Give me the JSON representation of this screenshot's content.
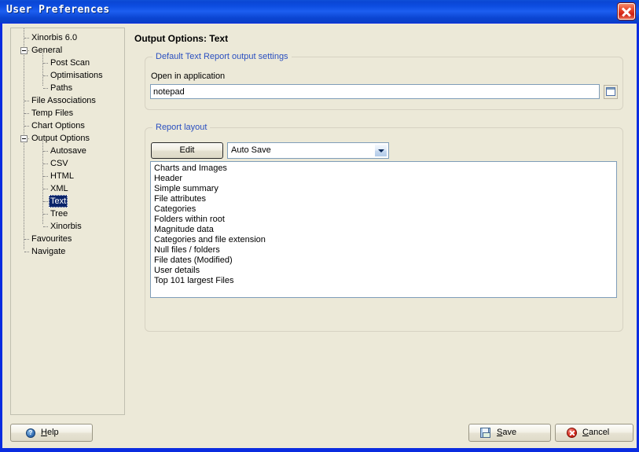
{
  "window": {
    "title": "User Preferences",
    "close_icon": "close-icon"
  },
  "tree": {
    "nodes": [
      {
        "label": "Xinorbis 6.0",
        "depth": 1,
        "expander": null,
        "selected": false
      },
      {
        "label": "General",
        "depth": 1,
        "expander": "collapse",
        "selected": false
      },
      {
        "label": "Post Scan",
        "depth": 2,
        "expander": null,
        "selected": false
      },
      {
        "label": "Optimisations",
        "depth": 2,
        "expander": null,
        "selected": false
      },
      {
        "label": "Paths",
        "depth": 2,
        "expander": null,
        "selected": false
      },
      {
        "label": "File Associations",
        "depth": 1,
        "expander": null,
        "selected": false
      },
      {
        "label": "Temp Files",
        "depth": 1,
        "expander": null,
        "selected": false
      },
      {
        "label": "Chart Options",
        "depth": 1,
        "expander": null,
        "selected": false
      },
      {
        "label": "Output Options",
        "depth": 1,
        "expander": "collapse",
        "selected": false
      },
      {
        "label": "Autosave",
        "depth": 2,
        "expander": null,
        "selected": false
      },
      {
        "label": "CSV",
        "depth": 2,
        "expander": null,
        "selected": false
      },
      {
        "label": "HTML",
        "depth": 2,
        "expander": null,
        "selected": false
      },
      {
        "label": "XML",
        "depth": 2,
        "expander": null,
        "selected": false
      },
      {
        "label": "Text",
        "depth": 2,
        "expander": null,
        "selected": true
      },
      {
        "label": "Tree",
        "depth": 2,
        "expander": null,
        "selected": false
      },
      {
        "label": "Xinorbis",
        "depth": 2,
        "expander": null,
        "selected": false
      },
      {
        "label": "Favourites",
        "depth": 1,
        "expander": null,
        "selected": false
      },
      {
        "label": "Navigate",
        "depth": 1,
        "expander": null,
        "selected": false
      }
    ]
  },
  "page": {
    "title": "Output Options: Text"
  },
  "default_output_group": {
    "legend": "Default Text Report output settings",
    "open_in_application_label": "Open in application",
    "open_in_application_value": "notepad",
    "open_in_application_placeholder": "",
    "browse_icon": "browse-folder-icon"
  },
  "report_layout_group": {
    "legend": "Report layout",
    "edit_button": "Edit",
    "preset_selected": "Auto Save",
    "preset_options": [
      "Auto Save"
    ],
    "items": [
      "Charts and Images",
      "Header",
      "Simple summary",
      "File attributes",
      "Categories",
      "Folders within root",
      "Magnitude data",
      "Categories and file extension",
      "Null files / folders",
      "File dates (Modified)",
      "User details",
      "Top 101 largest Files"
    ]
  },
  "footer": {
    "help": {
      "label_pre": "",
      "accel": "H",
      "label_post": "elp",
      "icon": "help-question-icon"
    },
    "save": {
      "label_pre": "",
      "accel": "S",
      "label_post": "ave",
      "icon": "floppy-disk-icon"
    },
    "cancel": {
      "label_pre": "",
      "accel": "C",
      "label_post": "ancel",
      "icon": "cancel-circle-icon"
    }
  },
  "colors": {
    "title_bar": "#0a46d4",
    "window_face": "#ece9d8",
    "group_legend": "#2a4fc0",
    "selection": "#0a246a",
    "field_border": "#7f9db9"
  }
}
